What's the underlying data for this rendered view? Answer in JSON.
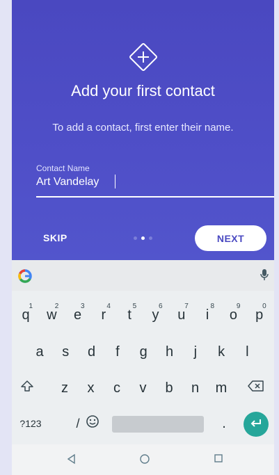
{
  "onboarding": {
    "title": "Add your first contact",
    "subtitle": "To add a contact, first enter their name.",
    "field_label": "Contact Name",
    "field_value": "Art Vandelay",
    "skip_label": "SKIP",
    "next_label": "NEXT",
    "page_count": 3,
    "active_page": 1,
    "colors": {
      "primary": "#4a48c0",
      "accent": "#ffffff"
    }
  },
  "keyboard": {
    "row1": [
      {
        "k": "q",
        "n": "1"
      },
      {
        "k": "w",
        "n": "2"
      },
      {
        "k": "e",
        "n": "3"
      },
      {
        "k": "r",
        "n": "4"
      },
      {
        "k": "t",
        "n": "5"
      },
      {
        "k": "y",
        "n": "6"
      },
      {
        "k": "u",
        "n": "7"
      },
      {
        "k": "i",
        "n": "8"
      },
      {
        "k": "o",
        "n": "9"
      },
      {
        "k": "p",
        "n": "0"
      }
    ],
    "row2": [
      "a",
      "s",
      "d",
      "f",
      "g",
      "h",
      "j",
      "k",
      "l"
    ],
    "row3": [
      "z",
      "x",
      "c",
      "v",
      "b",
      "n",
      "m"
    ],
    "symbols_label": "?123",
    "slash_label": "/",
    "period_label": ".",
    "enter_color": "#26a69a"
  }
}
